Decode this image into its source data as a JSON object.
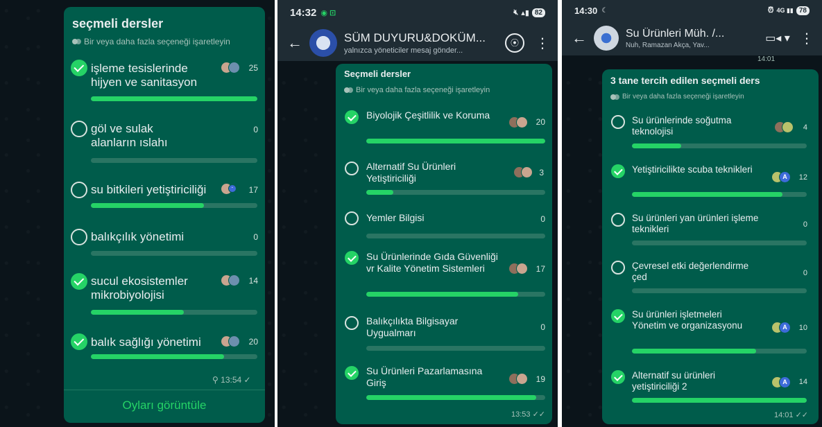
{
  "panel1": {
    "poll_title": "seçmeli dersler",
    "hint": "Bir veya daha fazla seçeneği işaretleyin",
    "options": [
      {
        "label": "işleme tesislerinde hijyen ve sanitasyon",
        "count": "25",
        "checked": true,
        "fill": 1.0
      },
      {
        "label": "göl ve sulak alanların ıslahı",
        "count": "0",
        "checked": false,
        "fill": 0.0
      },
      {
        "label": "su bitkileri yetiştiriciliği",
        "count": "17",
        "checked": false,
        "fill": 0.68
      },
      {
        "label": "balıkçılık yönetimi",
        "count": "0",
        "checked": false,
        "fill": 0.0
      },
      {
        "label": "sucul ekosistemler mikrobiyolojisi",
        "count": "14",
        "checked": true,
        "fill": 0.56
      },
      {
        "label": "balık sağlığı yönetimi",
        "count": "20",
        "checked": true,
        "fill": 0.8
      }
    ],
    "time": "13:54",
    "view_votes": "Oyları görüntüle"
  },
  "panel2": {
    "status_time": "14:32",
    "battery": "82",
    "chat_name": "SÜM DUYURU&DOKÜM...",
    "chat_sub": "yalnızca yöneticiler mesaj gönder...",
    "poll_title": "Seçmeli dersler",
    "hint": "Bir veya daha fazla seçeneği işaretleyin",
    "options": [
      {
        "label": "Biyolojik Çeşitlilik ve Koruma",
        "count": "20",
        "checked": true,
        "fill": 1.0
      },
      {
        "label": "Alternatif Su Ürünleri Yetiştiriciliği",
        "count": "3",
        "checked": false,
        "fill": 0.15
      },
      {
        "label": "Yemler Bilgisi",
        "count": "0",
        "checked": false,
        "fill": 0.0
      },
      {
        "label": "Su Ürünlerinde Gıda Güvenliği vr Kalite Yönetim Sistemleri",
        "count": "17",
        "checked": true,
        "fill": 0.85
      },
      {
        "label": "Balıkçılıkta Bilgisayar Uygualmarı",
        "count": "0",
        "checked": false,
        "fill": 0.0
      },
      {
        "label": "Su Ürünleri Pazarlamasına Giriş",
        "count": "19",
        "checked": true,
        "fill": 0.95
      }
    ],
    "time": "13:53"
  },
  "panel3": {
    "status_time": "14:30",
    "battery": "78",
    "chat_name": "Su Ürünleri Müh. /...",
    "chat_sub": "Nuh, Ramazan Akça, Yav...",
    "prev_time": "14:01",
    "poll_title": "3 tane tercih edilen seçmeli ders",
    "hint": "Bir veya daha fazla seçeneği işaretleyin",
    "options": [
      {
        "label": "Su ürünlerinde soğutma teknolojisi",
        "count": "4",
        "checked": false,
        "fill": 0.28
      },
      {
        "label": "Yetiştiricilikte scuba teknikleri",
        "count": "12",
        "checked": true,
        "fill": 0.86
      },
      {
        "label": "Su ürünleri yan ürünleri işleme teknikleri",
        "count": "0",
        "checked": false,
        "fill": 0.0
      },
      {
        "label": "Çevresel etki değerlendirme çed",
        "count": "0",
        "checked": false,
        "fill": 0.0
      },
      {
        "label": "Su ürünleri işletmeleri Yönetim ve organizasyonu",
        "count": "10",
        "checked": true,
        "fill": 0.71
      },
      {
        "label": "Alternatif su ürünleri yetiştiriciliği 2",
        "count": "14",
        "checked": true,
        "fill": 1.0
      }
    ],
    "avatar_letter": "A",
    "time": "14:01"
  },
  "colors": {
    "bubble": "#005c4b",
    "accent": "#25d366",
    "track": "#2a7563",
    "background": "#0b141a",
    "header": "#1f2c34"
  }
}
